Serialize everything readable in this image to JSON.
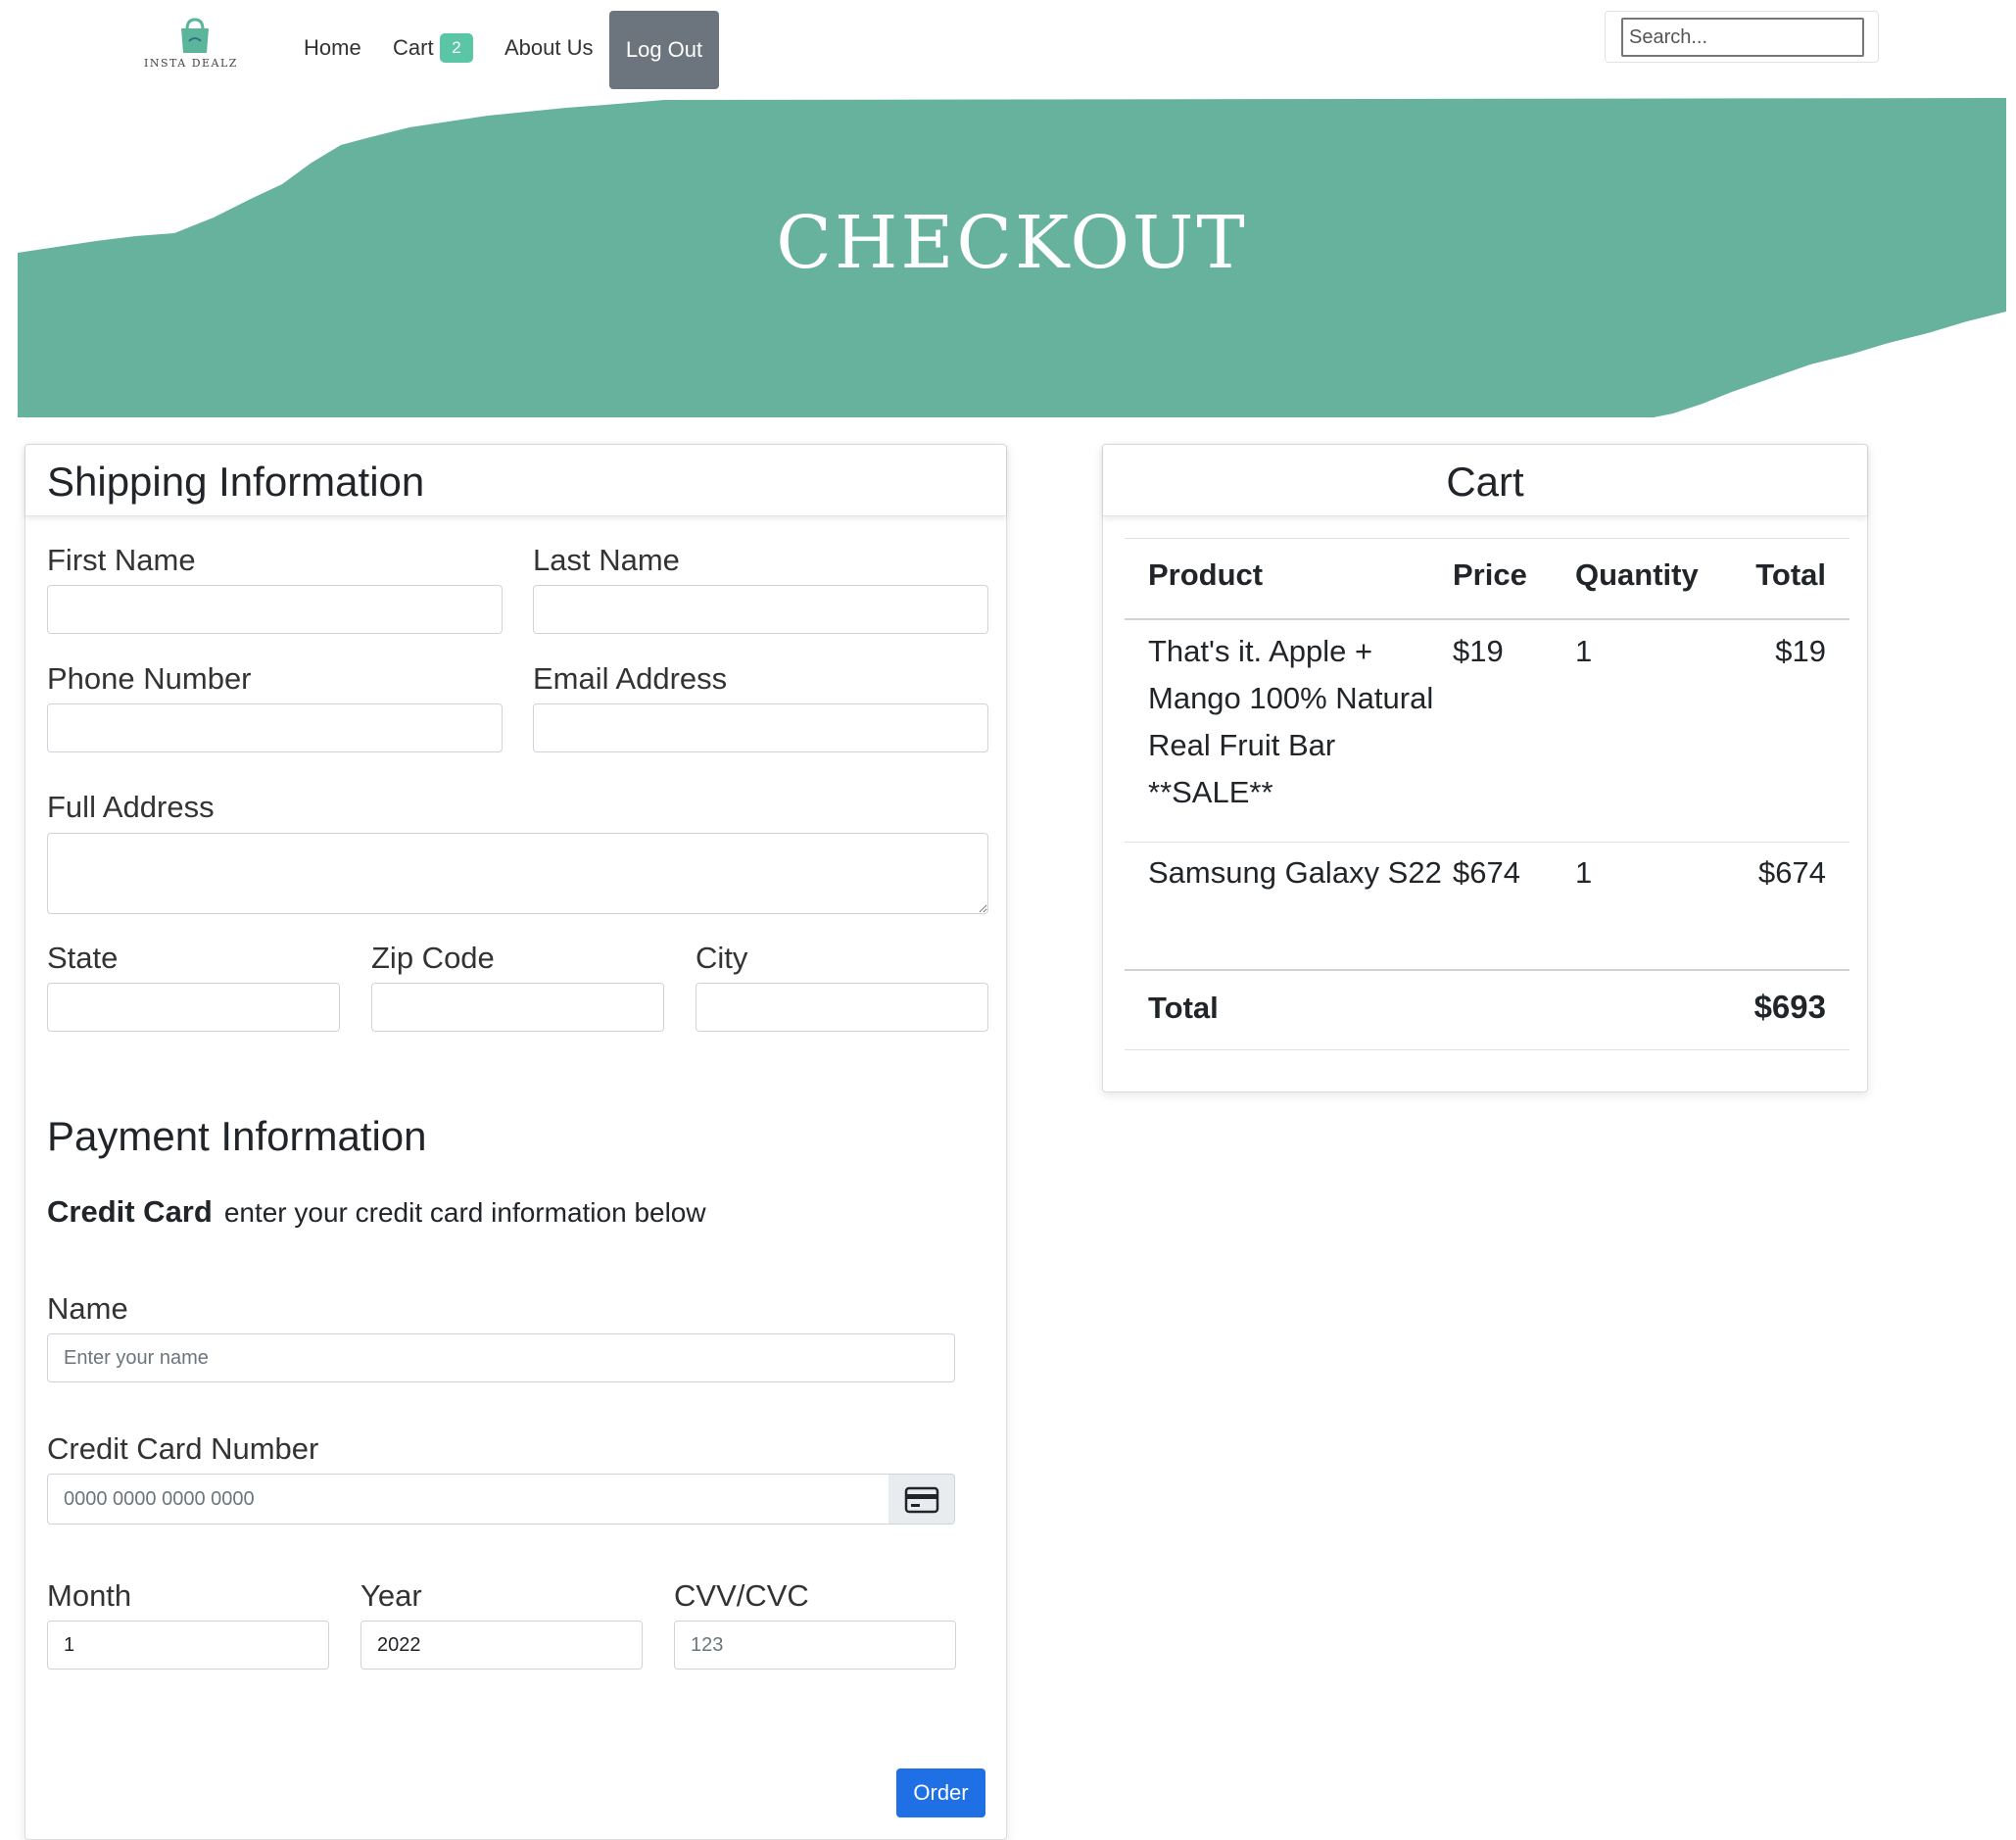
{
  "nav": {
    "logo_text": "INSTA DEALZ",
    "home": "Home",
    "cart": "Cart",
    "cart_count": "2",
    "about": "About Us",
    "logout": "Log Out",
    "search_placeholder": "Search..."
  },
  "banner": {
    "title": "CHECKOUT",
    "color": "#67b29c"
  },
  "shipping": {
    "title": "Shipping Information",
    "first_name": "First Name",
    "last_name": "Last Name",
    "phone": "Phone Number",
    "email": "Email Address",
    "address": "Full Address",
    "state": "State",
    "zip": "Zip Code",
    "city": "City"
  },
  "payment": {
    "title": "Payment Information",
    "method": "Credit Card",
    "instruction": "enter your credit card information below",
    "name_label": "Name",
    "name_placeholder": "Enter your name",
    "card_label": "Credit Card Number",
    "card_placeholder": "0000 0000 0000 0000",
    "month_label": "Month",
    "month_value": "1",
    "year_label": "Year",
    "year_value": "2022",
    "cvv_label": "CVV/CVC",
    "cvv_placeholder": "123",
    "order_button": "Order",
    "order_color": "#1f6fe5"
  },
  "cart": {
    "title": "Cart",
    "headers": {
      "product": "Product",
      "price": "Price",
      "quantity": "Quantity",
      "total": "Total"
    },
    "items": [
      {
        "product": "That's it. Apple + Mango 100% Natural Real Fruit Bar **SALE**",
        "price": "$19",
        "quantity": "1",
        "total": "$19"
      },
      {
        "product": "Samsung Galaxy S22",
        "price": "$674",
        "quantity": "1",
        "total": "$674"
      }
    ],
    "total_label": "Total",
    "total_value": "$693"
  }
}
